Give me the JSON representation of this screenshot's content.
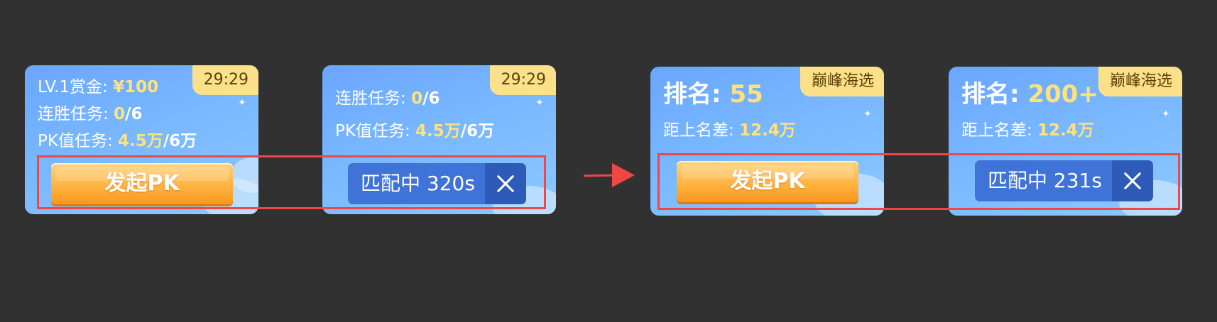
{
  "cards": [
    {
      "timer": "29:29",
      "bounty_label": "LV.1赏金: ",
      "bounty_value": "¥100",
      "streak_label": "连胜任务: ",
      "streak_done": "0",
      "streak_total": "/6",
      "pk_label": "PK值任务: ",
      "pk_done": "4.5万",
      "pk_total": "/6万",
      "button_label": "发起PK"
    },
    {
      "timer": "29:29",
      "streak_label": "连胜任务: ",
      "streak_done": "0",
      "streak_total": "/6",
      "pk_label": "PK值任务: ",
      "pk_done": "4.5万",
      "pk_total": "/6万",
      "matching_label": "匹配中 320s"
    },
    {
      "tag": "巅峰海选",
      "rank_label": "排名: ",
      "rank_value": "55",
      "gap_label": "距上名差: ",
      "gap_value": "12.4万",
      "button_label": "发起PK"
    },
    {
      "tag": "巅峰海选",
      "rank_label": "排名: ",
      "rank_value": "200+",
      "gap_label": "距上名差: ",
      "gap_value": "12.4万",
      "matching_label": "匹配中 231s"
    }
  ],
  "colors": {
    "background": "#313131",
    "highlight": "#ffe27a",
    "tag": "#fde08a",
    "annotation": "#f04646"
  },
  "icons": {
    "close": "close-icon",
    "arrow": "right-arrow-icon"
  }
}
